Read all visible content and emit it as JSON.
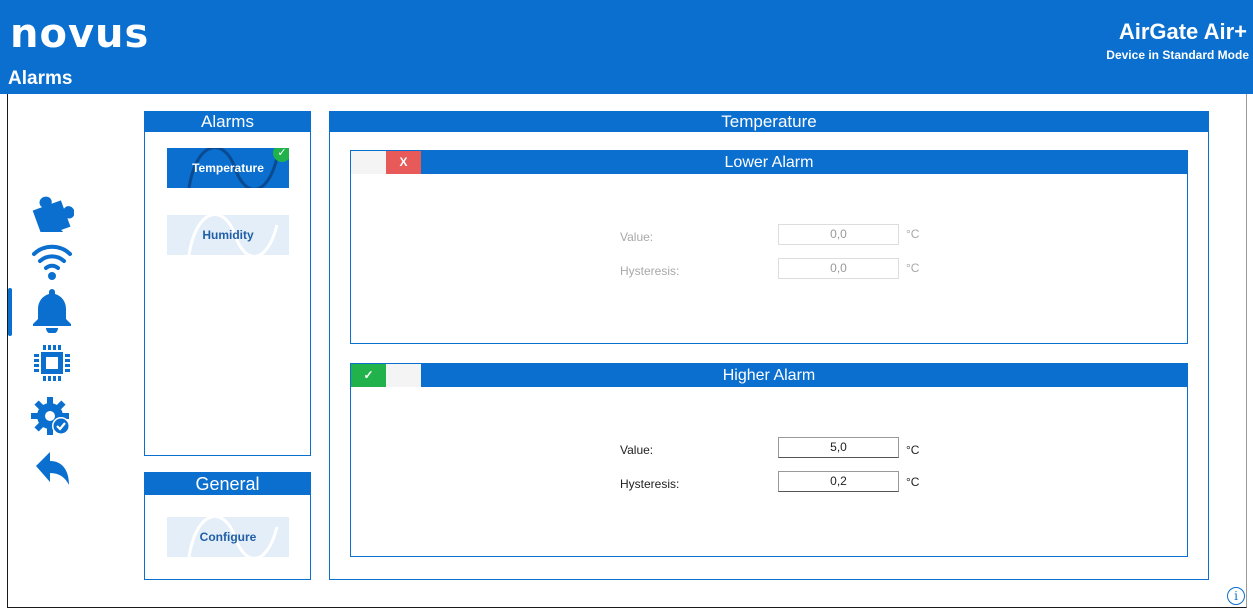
{
  "header": {
    "logo": "novus",
    "page_title": "Alarms",
    "product_name": "AirGate Air+",
    "device_mode": "Device in Standard Mode"
  },
  "nav": {
    "items": [
      {
        "icon": "puzzle-icon"
      },
      {
        "icon": "wifi-icon"
      },
      {
        "icon": "bell-icon",
        "active": true
      },
      {
        "icon": "chip-icon"
      },
      {
        "icon": "gear-check-icon"
      },
      {
        "icon": "back-arrow-icon"
      }
    ]
  },
  "alarms_panel": {
    "title": "Alarms",
    "items": [
      {
        "label": "Temperature",
        "active": true,
        "enabled": true
      },
      {
        "label": "Humidity",
        "active": false
      }
    ]
  },
  "general_panel": {
    "title": "General",
    "configure_label": "Configure"
  },
  "main_panel": {
    "title": "Temperature",
    "lower_alarm": {
      "title": "Lower Alarm",
      "toggle_off_label": "X",
      "enabled": false,
      "value_label": "Value:",
      "value": "0,0",
      "value_unit": "°C",
      "hysteresis_label": "Hysteresis:",
      "hysteresis": "0,0",
      "hysteresis_unit": "°C"
    },
    "higher_alarm": {
      "title": "Higher Alarm",
      "toggle_on_label": "✓",
      "enabled": true,
      "value_label": "Value:",
      "value": "5,0",
      "value_unit": "°C",
      "hysteresis_label": "Hysteresis:",
      "hysteresis": "0,2",
      "hysteresis_unit": "°C"
    }
  },
  "colors": {
    "primary": "#0a6fcf",
    "success": "#22b24c",
    "danger": "#e85a5a"
  }
}
